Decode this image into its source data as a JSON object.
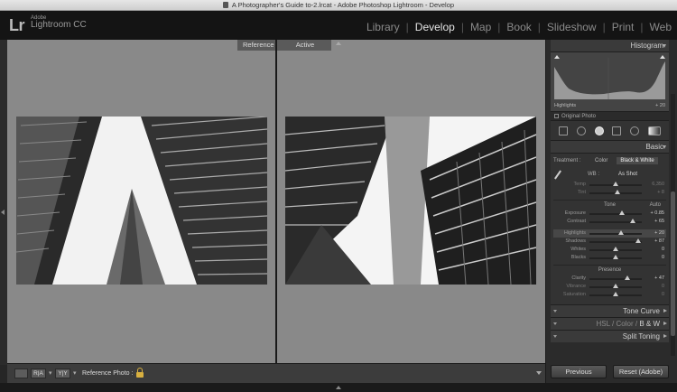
{
  "window": {
    "title": "A Photographer's Guide to-2.lrcat - Adobe Photoshop Lightroom - Develop"
  },
  "identity": {
    "logo": "Lr",
    "brand_top": "Adobe",
    "brand_bottom": "Lightroom CC"
  },
  "modules": [
    "Library",
    "Develop",
    "Map",
    "Book",
    "Slideshow",
    "Print",
    "Web"
  ],
  "active_module": "Develop",
  "view": {
    "reference_label": "Reference",
    "active_label": "Active"
  },
  "toolbar": {
    "ra_label": "R|A",
    "yy_label": "Y|Y",
    "reference_photo_label": "Reference Photo :"
  },
  "right_panel": {
    "histogram": {
      "title": "Histogram",
      "info_label": "Highlights",
      "info_value": "+ 20",
      "original_photo_label": "Original Photo"
    },
    "basic": {
      "title": "Basic",
      "treatment_label": "Treatment :",
      "treatment_color": "Color",
      "treatment_bw": "Black & White",
      "wb_label": "WB :",
      "wb_value": "As Shot",
      "tone_label": "Tone",
      "auto_label": "Auto",
      "presence_label": "Presence",
      "sliders": {
        "temp": {
          "label": "Temp",
          "value": "6,350",
          "pos": 0.5
        },
        "tint": {
          "label": "Tint",
          "value": "+ 8",
          "pos": 0.54
        },
        "exposure": {
          "label": "Exposure",
          "value": "+ 0.85",
          "pos": 0.62
        },
        "contrast": {
          "label": "Contrast",
          "value": "+ 65",
          "pos": 0.82
        },
        "highlights": {
          "label": "Highlights",
          "value": "+ 20",
          "pos": 0.6
        },
        "shadows": {
          "label": "Shadows",
          "value": "+ 87",
          "pos": 0.93
        },
        "whites": {
          "label": "Whites",
          "value": "0",
          "pos": 0.5
        },
        "blacks": {
          "label": "Blacks",
          "value": "0",
          "pos": 0.5
        },
        "clarity": {
          "label": "Clarity",
          "value": "+ 47",
          "pos": 0.73
        },
        "vibrance": {
          "label": "Vibrance",
          "value": "0",
          "pos": 0.5
        },
        "saturation": {
          "label": "Saturation",
          "value": "0",
          "pos": 0.5
        }
      }
    },
    "tone_curve": {
      "title": "Tone Curve"
    },
    "hsl": {
      "hsl": "HSL",
      "color": "Color",
      "bw": "B & W",
      "sep": "/"
    },
    "split_toning": {
      "title": "Split Toning"
    },
    "previous_button": "Previous",
    "reset_button": "Reset (Adobe)"
  },
  "colors": {
    "accent": "#e4e4e4",
    "panel": "#2b2b2b",
    "canvas": "#898989",
    "lock": "#d8b040"
  }
}
